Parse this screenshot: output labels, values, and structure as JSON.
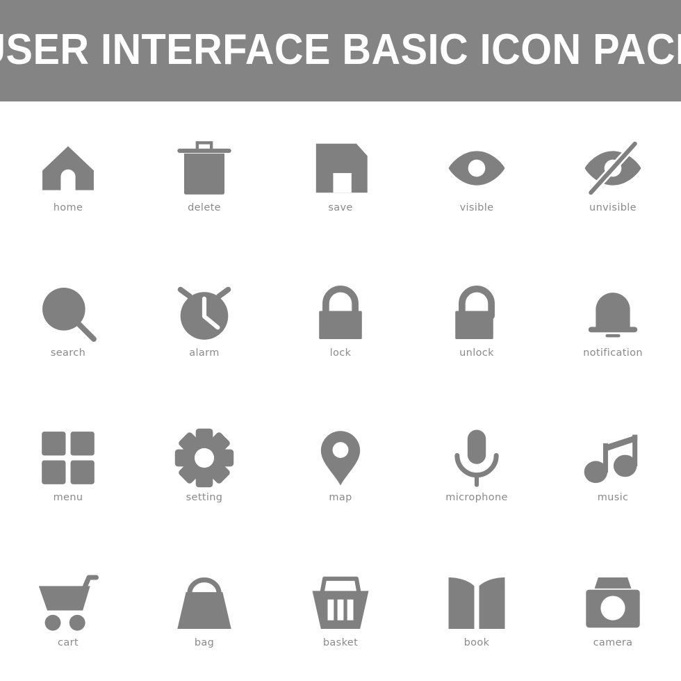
{
  "header": {
    "title": "USER INTERFACE BASIC ICON PACK",
    "background_color": "#848484",
    "text_color": "#ffffff"
  },
  "theme": {
    "page_background": "#ffffff",
    "icon_color": "#808080",
    "label_color": "#8a8a8a",
    "cutout_color": "#ffffff"
  },
  "grid": {
    "columns": 5,
    "rows": 4,
    "total_icons": 20
  },
  "icons": [
    {
      "id": "home",
      "label": "home",
      "glyph": "home-icon"
    },
    {
      "id": "delete",
      "label": "delete",
      "glyph": "trash-icon"
    },
    {
      "id": "save",
      "label": "save",
      "glyph": "floppy-disk-icon"
    },
    {
      "id": "visible",
      "label": "visible",
      "glyph": "eye-icon"
    },
    {
      "id": "unvisible",
      "label": "unvisible",
      "glyph": "eye-slash-icon"
    },
    {
      "id": "search",
      "label": "search",
      "glyph": "magnifier-icon"
    },
    {
      "id": "alarm",
      "label": "alarm",
      "glyph": "alarm-clock-icon"
    },
    {
      "id": "lock",
      "label": "lock",
      "glyph": "padlock-closed-icon"
    },
    {
      "id": "unlock",
      "label": "unlock",
      "glyph": "padlock-open-icon"
    },
    {
      "id": "notification",
      "label": "notification",
      "glyph": "bell-icon"
    },
    {
      "id": "menu",
      "label": "menu",
      "glyph": "grid-squares-icon"
    },
    {
      "id": "setting",
      "label": "setting",
      "glyph": "gear-icon"
    },
    {
      "id": "map",
      "label": "map",
      "glyph": "map-pin-icon"
    },
    {
      "id": "microphone",
      "label": "microphone",
      "glyph": "microphone-icon"
    },
    {
      "id": "music",
      "label": "music",
      "glyph": "music-note-icon"
    },
    {
      "id": "cart",
      "label": "cart",
      "glyph": "shopping-cart-icon"
    },
    {
      "id": "bag",
      "label": "bag",
      "glyph": "handbag-icon"
    },
    {
      "id": "basket",
      "label": "basket",
      "glyph": "shopping-basket-icon"
    },
    {
      "id": "book",
      "label": "book",
      "glyph": "open-book-icon"
    },
    {
      "id": "camera",
      "label": "camera",
      "glyph": "camera-icon"
    }
  ]
}
